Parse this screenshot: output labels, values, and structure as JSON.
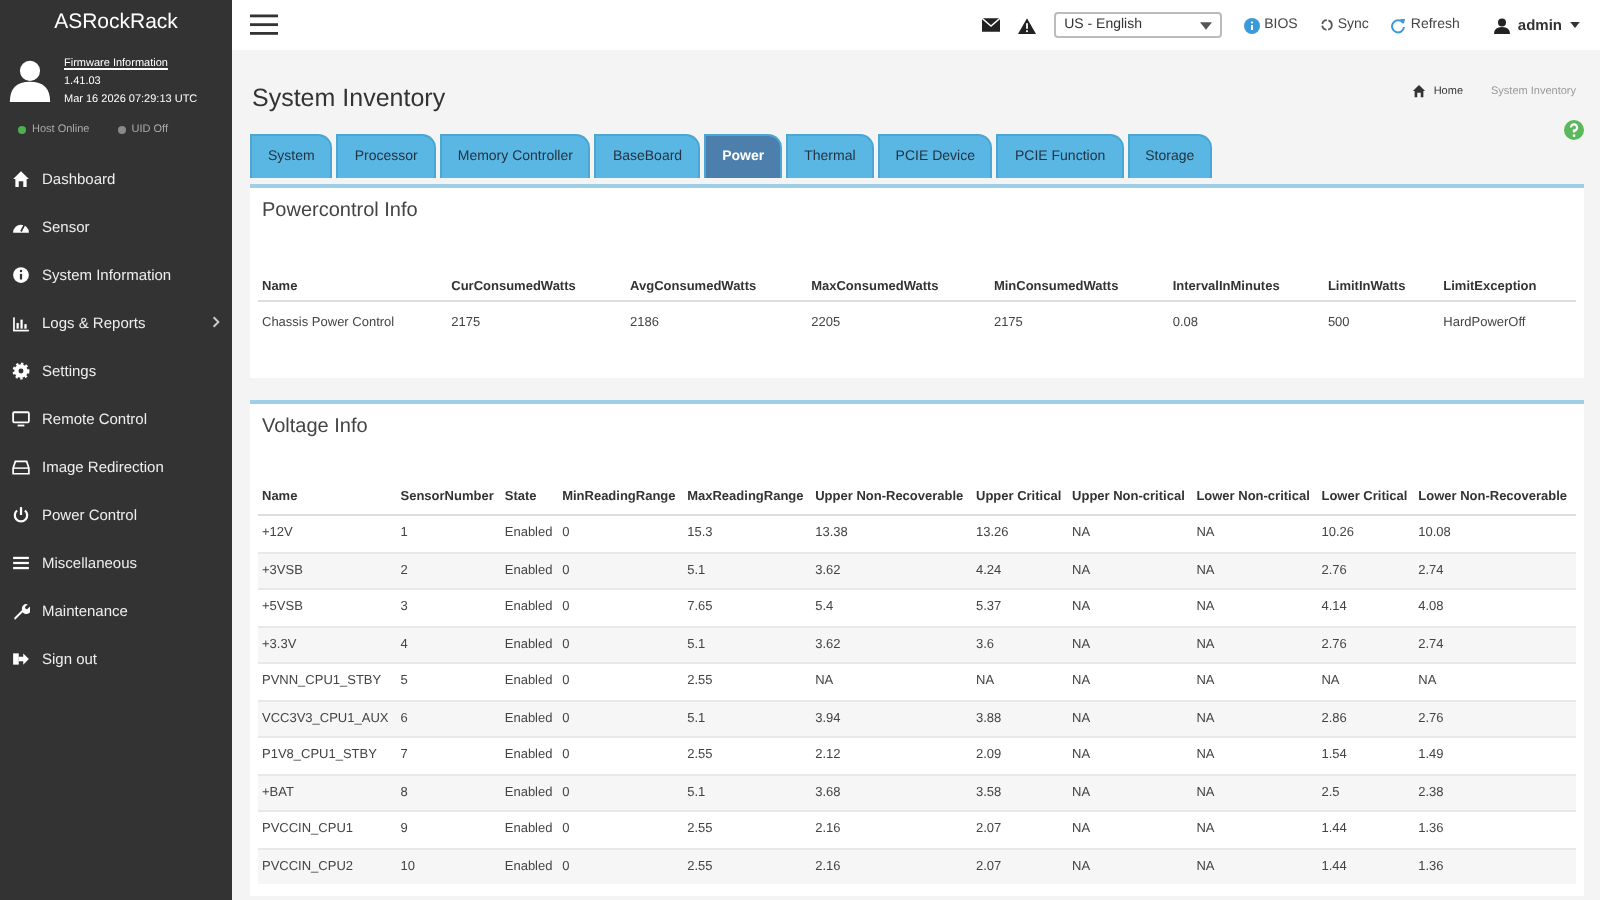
{
  "sidebar": {
    "brand": "ASRockRack",
    "firmware_link": "Firmware Information",
    "version": "1.41.03",
    "datetime": "Mar 16 2026 07:29:13 UTC",
    "status": [
      {
        "label": "Host Online",
        "color": "#4caf50"
      },
      {
        "label": "UID Off",
        "color": "#8a8a8a"
      }
    ],
    "items": [
      {
        "label": "Dashboard",
        "kind": "home",
        "submenu": false
      },
      {
        "label": "Sensor",
        "kind": "gauge",
        "submenu": false
      },
      {
        "label": "System Information",
        "kind": "info",
        "submenu": false
      },
      {
        "label": "Logs & Reports",
        "kind": "chart",
        "submenu": true
      },
      {
        "label": "Settings",
        "kind": "gear",
        "submenu": false
      },
      {
        "label": "Remote Control",
        "kind": "monitor",
        "submenu": false
      },
      {
        "label": "Image Redirection",
        "kind": "drive",
        "submenu": false
      },
      {
        "label": "Power Control",
        "kind": "power",
        "submenu": false
      },
      {
        "label": "Miscellaneous",
        "kind": "menu",
        "submenu": false
      },
      {
        "label": "Maintenance",
        "kind": "wrench",
        "submenu": false
      },
      {
        "label": "Sign out",
        "kind": "signout",
        "submenu": false
      }
    ]
  },
  "topbar": {
    "language": "US - English",
    "links": [
      {
        "label": "BIOS",
        "kind": "info"
      },
      {
        "label": "Sync",
        "kind": "sync"
      },
      {
        "label": "Refresh",
        "kind": "refresh"
      }
    ],
    "user": "admin"
  },
  "page_title": "System Inventory",
  "breadcrumb": [
    "Home",
    "System Inventory"
  ],
  "tabs": [
    {
      "label": "System",
      "selected": false
    },
    {
      "label": "Processor",
      "selected": false
    },
    {
      "label": "Memory Controller",
      "selected": false
    },
    {
      "label": "BaseBoard",
      "selected": false
    },
    {
      "label": "Power",
      "selected": true
    },
    {
      "label": "Thermal",
      "selected": false
    },
    {
      "label": "PCIE Device",
      "selected": false
    },
    {
      "label": "PCIE Function",
      "selected": false
    },
    {
      "label": "Storage",
      "selected": false
    }
  ],
  "powercontrol": {
    "title": "Powercontrol Info",
    "columns": [
      "Name",
      "CurConsumedWatts",
      "AvgConsumedWatts",
      "MaxConsumedWatts",
      "MinConsumedWatts",
      "IntervalInMinutes",
      "LimitInWatts",
      "LimitException"
    ],
    "rows": [
      [
        "Chassis Power Control",
        "2175",
        "2186",
        "2205",
        "2175",
        "0.08",
        "500",
        "HardPowerOff"
      ]
    ]
  },
  "voltage": {
    "title": "Voltage Info",
    "columns": [
      "Name",
      "SensorNumber",
      "State",
      "MinReadingRange",
      "MaxReadingRange",
      "Upper Non-Recoverable",
      "Upper Critical",
      "Upper Non-critical",
      "Lower Non-critical",
      "Lower Critical",
      "Lower Non-Recoverable"
    ],
    "rows": [
      [
        "+12V",
        "1",
        "Enabled",
        "0",
        "15.3",
        "13.38",
        "13.26",
        "NA",
        "NA",
        "10.26",
        "10.08"
      ],
      [
        "+3VSB",
        "2",
        "Enabled",
        "0",
        "5.1",
        "3.62",
        "4.24",
        "NA",
        "NA",
        "2.76",
        "2.74"
      ],
      [
        "+5VSB",
        "3",
        "Enabled",
        "0",
        "7.65",
        "5.4",
        "5.37",
        "NA",
        "NA",
        "4.14",
        "4.08"
      ],
      [
        "+3.3V",
        "4",
        "Enabled",
        "0",
        "5.1",
        "3.62",
        "3.6",
        "NA",
        "NA",
        "2.76",
        "2.74"
      ],
      [
        "PVNN_CPU1_STBY",
        "5",
        "Enabled",
        "0",
        "2.55",
        "NA",
        "NA",
        "NA",
        "NA",
        "NA",
        "NA"
      ],
      [
        "VCC3V3_CPU1_AUX",
        "6",
        "Enabled",
        "0",
        "5.1",
        "3.94",
        "3.88",
        "NA",
        "NA",
        "2.86",
        "2.76"
      ],
      [
        "P1V8_CPU1_STBY",
        "7",
        "Enabled",
        "0",
        "2.55",
        "2.12",
        "2.09",
        "NA",
        "NA",
        "1.54",
        "1.49"
      ],
      [
        "+BAT",
        "8",
        "Enabled",
        "0",
        "5.1",
        "3.68",
        "3.58",
        "NA",
        "NA",
        "2.5",
        "2.38"
      ],
      [
        "PVCCIN_CPU1",
        "9",
        "Enabled",
        "0",
        "2.55",
        "2.16",
        "2.07",
        "NA",
        "NA",
        "1.44",
        "1.36"
      ],
      [
        "PVCCIN_CPU2",
        "10",
        "Enabled",
        "0",
        "2.55",
        "2.16",
        "2.07",
        "NA",
        "NA",
        "1.44",
        "1.36"
      ]
    ]
  }
}
